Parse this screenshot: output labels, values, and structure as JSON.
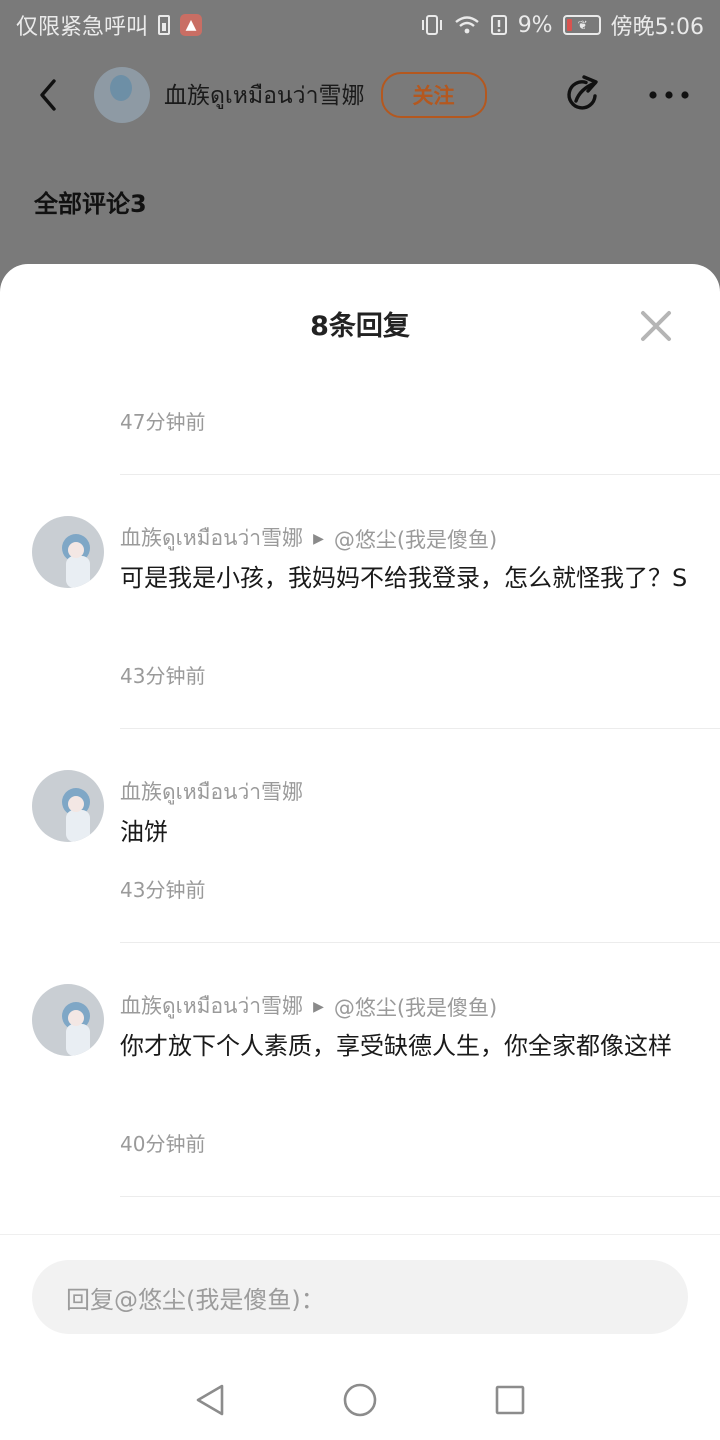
{
  "status_bar": {
    "left_text": "仅限紧急呼叫",
    "battery_percent": "9%",
    "time": "傍晚5:06"
  },
  "header": {
    "username": "血族ดูเหมือนว่า雪娜",
    "follow_label": "关注"
  },
  "background": {
    "comments_heading": "全部评论3"
  },
  "sheet": {
    "title": "8条回复",
    "first_time": "47分钟前",
    "replies": [
      {
        "user": "血族ดูเหมือนว่า雪娜",
        "reply_to": "@悠尘(我是傻鱼)",
        "text": "可是我是小孩，我妈妈不给我登录，怎么就怪我了？S",
        "time": "43分钟前"
      },
      {
        "user": "血族ดูเหมือนว่า雪娜",
        "reply_to": "",
        "text": "油饼",
        "time": "43分钟前"
      },
      {
        "user": "血族ดูเหมือนว่า雪娜",
        "reply_to": "@悠尘(我是傻鱼)",
        "text": "你才放下个人素质，享受缺德人生，你全家都像这样",
        "time": "40分钟前"
      }
    ],
    "input_placeholder": "回复@悠尘(我是傻鱼)："
  },
  "icons": {
    "back": "chevron-left-icon",
    "share": "share-icon",
    "more": "more-icon",
    "close": "close-icon"
  },
  "colors": {
    "accent": "#b4581f",
    "overlay": "#7a7a7a"
  }
}
